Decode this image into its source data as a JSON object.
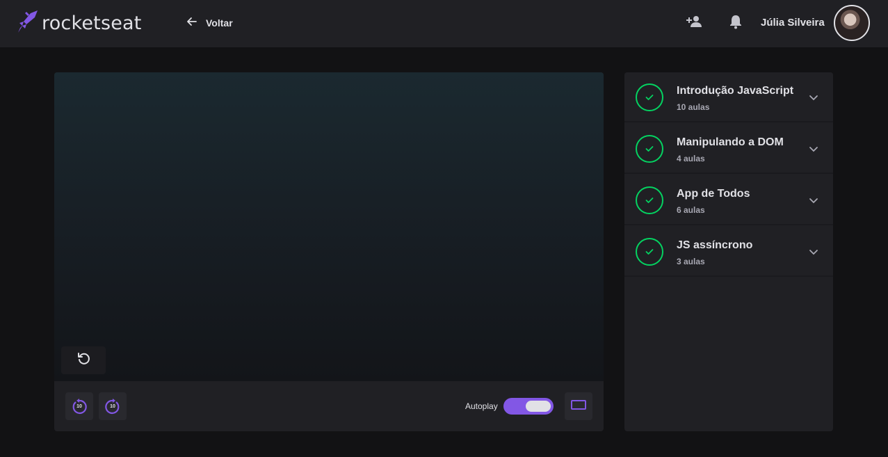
{
  "header": {
    "logo_text": "rocketseat",
    "back_label": "Voltar",
    "user_name": "Júlia Silveira",
    "icons": [
      "rocket-logo-icon",
      "arrow-left-icon",
      "add-user-icon",
      "bell-icon"
    ]
  },
  "player": {
    "controls": {
      "rewind_label": "10",
      "forward_label": "10",
      "autoplay_label": "Autoplay",
      "autoplay_on": true
    }
  },
  "modules": [
    {
      "title": "Introdução JavaScript",
      "subtitle": "10 aulas",
      "completed": true
    },
    {
      "title": "Manipulando a DOM",
      "subtitle": "4 aulas",
      "completed": true
    },
    {
      "title": "App de Todos",
      "subtitle": "6 aulas",
      "completed": true
    },
    {
      "title": "JS assíncrono",
      "subtitle": "3 aulas",
      "completed": true
    }
  ],
  "colors": {
    "accent": "#8257e5",
    "success": "#04d361",
    "background": "#121214",
    "surface": "#202024"
  }
}
